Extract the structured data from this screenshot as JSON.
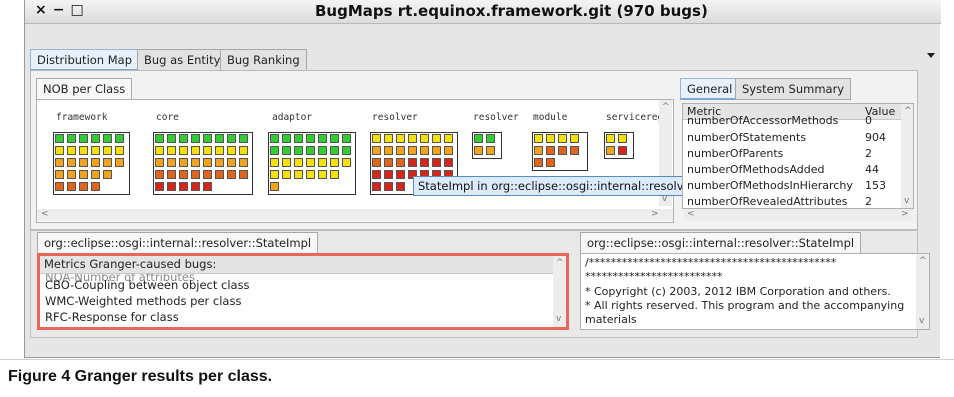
{
  "window": {
    "title": "BugMaps rt.equinox.framework.git (970 bugs)",
    "controls": [
      "×",
      "−",
      "□"
    ]
  },
  "main_tabs": [
    {
      "label": "Distribution Map",
      "active": true
    },
    {
      "label": "Bug as Entity",
      "active": false
    },
    {
      "label": "Bug Ranking",
      "active": false
    }
  ],
  "sub_tab": {
    "label": "NOB per Class"
  },
  "packages": [
    {
      "label": "framework"
    },
    {
      "label": "core"
    },
    {
      "label": "adaptor"
    },
    {
      "label": "resolver"
    },
    {
      "label": "resolver"
    },
    {
      "label": "module"
    },
    {
      "label": "serviceregi"
    }
  ],
  "colors": {
    "green": "#33cc33",
    "yellow": "#f6e00a",
    "orange": "#f2a21c",
    "dark_orange": "#e2631a",
    "red": "#d8251a",
    "highlight": "#e8675a"
  },
  "tooltip": {
    "text": "StateImpl in org::eclipse::osgi::internal::resolver (Class)"
  },
  "right_tabs": [
    {
      "label": "General",
      "active": true
    },
    {
      "label": "System Summary",
      "active": false
    }
  ],
  "metrics_table": {
    "headers": {
      "metric": "Metric",
      "value": "Value"
    },
    "rows": [
      {
        "metric": "numberOfAccessorMethods",
        "value": "0"
      },
      {
        "metric": "numberOfStatements",
        "value": "904"
      },
      {
        "metric": "numberOfParents",
        "value": "2"
      },
      {
        "metric": "numberOfMethodsAdded",
        "value": "44"
      },
      {
        "metric": "numberOfMethodsInHierarchy",
        "value": "153"
      },
      {
        "metric": "numberOfRevealedAttributes",
        "value": "2"
      }
    ]
  },
  "bottom_left_tab": {
    "label": "org::eclipse::osgi::internal::resolver::StateImpl"
  },
  "bottom_right_tab": {
    "label": "org::eclipse::osgi::internal::resolver::StateImpl"
  },
  "granger_list": {
    "header": "Metrics Granger-caused bugs:",
    "partial_item": "NOA-Number of attributes",
    "items": [
      "CBO-Coupling between object class",
      "WMC-Weighted methods per class",
      "RFC-Response for class"
    ]
  },
  "source": {
    "lines": [
      "/*********************************************",
      "*************************",
      " * Copyright (c) 2003, 2012 IBM Corporation and others.",
      " * All rights reserved. This program and the accompanying",
      "materials"
    ]
  },
  "caption": "Figure 4 Granger results per class."
}
